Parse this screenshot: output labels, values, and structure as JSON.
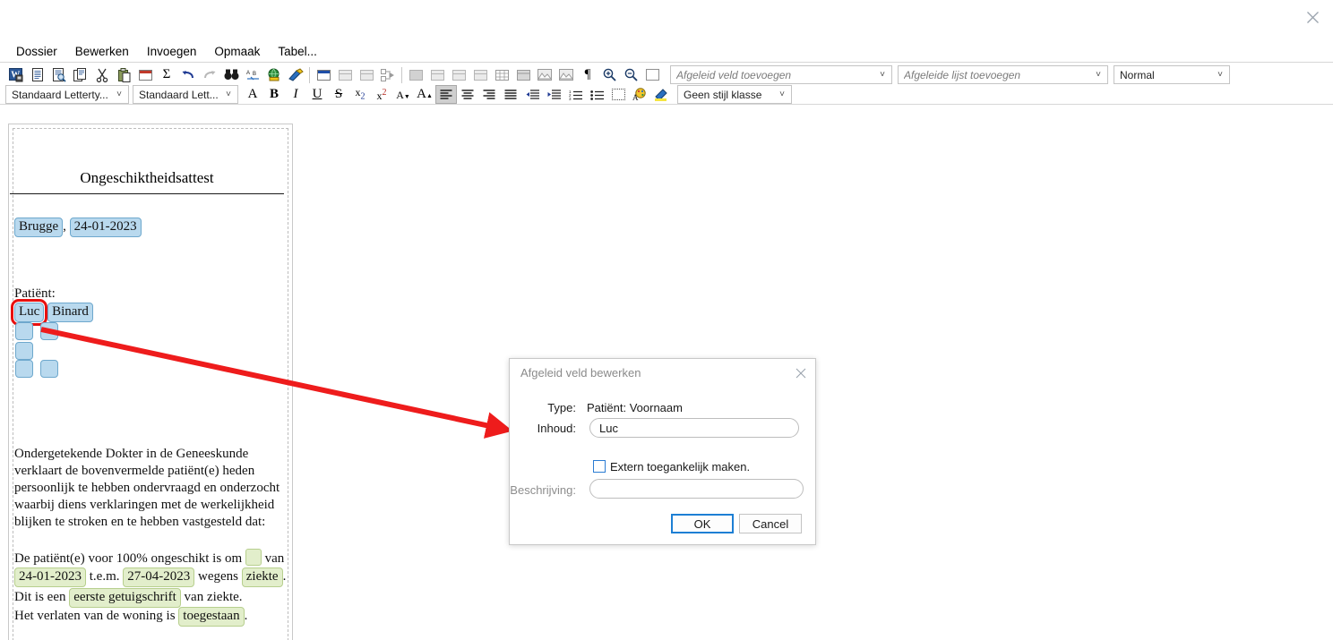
{
  "window": {
    "close_icon": "close-icon"
  },
  "menubar": {
    "items": [
      {
        "label": "Dossier"
      },
      {
        "label": "Bewerken"
      },
      {
        "label": "Invoegen"
      },
      {
        "label": "Opmaak"
      },
      {
        "label": "Tabel..."
      }
    ]
  },
  "toolbar": {
    "row1": [
      {
        "name": "save-document-icon",
        "glyph": "W",
        "kind": "word"
      },
      {
        "name": "new-document-icon",
        "glyph": "☰",
        "kind": "doc"
      },
      {
        "name": "print-preview-icon",
        "glyph": "⌕",
        "kind": "preview"
      },
      {
        "name": "copy-icon",
        "glyph": "⧉",
        "kind": "copy"
      },
      {
        "name": "cut-icon",
        "glyph": "✂",
        "kind": "cut"
      },
      {
        "name": "paste-icon",
        "glyph": "ὌB",
        "kind": "paste"
      },
      {
        "name": "insert-table-icon",
        "glyph": "▦",
        "kind": "grid-red"
      },
      {
        "name": "sum-icon",
        "glyph": "Σ",
        "kind": "text"
      },
      {
        "name": "undo-icon",
        "glyph": "↶",
        "kind": "undo"
      },
      {
        "name": "redo-icon",
        "glyph": "↷",
        "kind": "redo-dim"
      },
      {
        "name": "find-icon",
        "glyph": "இ",
        "kind": "binoculars"
      },
      {
        "name": "spellcheck-icon",
        "glyph": "ABC",
        "kind": "spell"
      },
      {
        "name": "hyperlink-icon",
        "glyph": "ἱ0",
        "kind": "globe"
      },
      {
        "name": "format-painter-icon",
        "glyph": "✎",
        "kind": "brush"
      },
      {
        "name": "table-properties-icon",
        "glyph": "▦",
        "kind": "grid-blue"
      },
      {
        "name": "table-row-icon",
        "glyph": "▦",
        "kind": "grid-gray"
      },
      {
        "name": "table-column-icon",
        "glyph": "▦",
        "kind": "grid-gray"
      },
      {
        "name": "table-split-icon",
        "glyph": "▦",
        "kind": "grid-gray"
      },
      {
        "name": "split-cells-icon",
        "glyph": "⎇",
        "kind": "split"
      },
      {
        "name": "merge-cells-icon",
        "glyph": "▦",
        "kind": "grid-filled"
      },
      {
        "name": "table-cell-a-icon",
        "glyph": "▦",
        "kind": "grid-gray"
      },
      {
        "name": "table-cell-b-icon",
        "glyph": "▦",
        "kind": "grid-gray"
      },
      {
        "name": "table-cell-c-icon",
        "glyph": "▦",
        "kind": "grid-gray"
      },
      {
        "name": "table-cell-d-icon",
        "glyph": "▦",
        "kind": "grid-gray"
      },
      {
        "name": "table-grid-lines-icon",
        "glyph": "▦",
        "kind": "grid-gray"
      },
      {
        "name": "table-shading-icon",
        "glyph": "▦",
        "kind": "grid-gray"
      },
      {
        "name": "insert-image-icon",
        "glyph": "⛰",
        "kind": "image"
      },
      {
        "name": "insert-image-alt-icon",
        "glyph": "⛰",
        "kind": "image"
      },
      {
        "name": "show-formatting-marks-icon",
        "glyph": "¶",
        "kind": "text"
      },
      {
        "name": "zoom-in-icon",
        "glyph": "⊕",
        "kind": "zoomin"
      },
      {
        "name": "zoom-out-icon",
        "glyph": "⊖",
        "kind": "zoomout"
      },
      {
        "name": "page-border-icon",
        "glyph": "□",
        "kind": "square"
      }
    ],
    "row2": [
      {
        "name": "font-color-a-icon",
        "glyph": "A",
        "kind": "serifA"
      },
      {
        "name": "bold-icon",
        "glyph": "B",
        "kind": "bold"
      },
      {
        "name": "italic-icon",
        "glyph": "I",
        "kind": "italic"
      },
      {
        "name": "underline-icon",
        "glyph": "U",
        "kind": "underline"
      },
      {
        "name": "strikethrough-icon",
        "glyph": "S",
        "kind": "strike"
      },
      {
        "name": "subscript-icon",
        "glyph": "x₂",
        "kind": "sub"
      },
      {
        "name": "superscript-icon",
        "glyph": "x²",
        "kind": "sup"
      },
      {
        "name": "decrease-font-size-icon",
        "glyph": "A▾",
        "kind": "fontdown"
      },
      {
        "name": "increase-font-size-icon",
        "glyph": "A▴",
        "kind": "fontup"
      },
      {
        "name": "align-left-icon",
        "glyph": "≡",
        "kind": "align",
        "active": true
      },
      {
        "name": "align-center-icon",
        "glyph": "≡",
        "kind": "align"
      },
      {
        "name": "align-right-icon",
        "glyph": "≡",
        "kind": "align"
      },
      {
        "name": "align-justify-icon",
        "glyph": "≡",
        "kind": "align"
      },
      {
        "name": "decrease-indent-icon",
        "glyph": "⇤",
        "kind": "indent"
      },
      {
        "name": "increase-indent-icon",
        "glyph": "⇥",
        "kind": "indent"
      },
      {
        "name": "numbered-list-icon",
        "glyph": "☰",
        "kind": "numlist"
      },
      {
        "name": "bulleted-list-icon",
        "glyph": "☰",
        "kind": "bullist"
      },
      {
        "name": "borders-icon",
        "glyph": "⬚",
        "kind": "dashbox"
      },
      {
        "name": "font-color-icon",
        "glyph": "◕",
        "kind": "palette"
      },
      {
        "name": "highlight-color-icon",
        "glyph": "✎",
        "kind": "highlighter"
      }
    ],
    "font_family": {
      "value": "Standaard Letterty...",
      "name": "font-family-select"
    },
    "font_style": {
      "value": "Standaard Lett...",
      "name": "font-style-select"
    },
    "derived_field": {
      "placeholder": "Afgeleid veld toevoegen",
      "name": "derived-field-select"
    },
    "derived_list": {
      "placeholder": "Afgeleide lijst toevoegen",
      "name": "derived-list-select"
    },
    "paragraph_style": {
      "value": "Normal",
      "name": "paragraph-style-select"
    },
    "style_class": {
      "value": "Geen stijl klasse",
      "name": "style-class-select"
    }
  },
  "document": {
    "title": "Ongeschiktheidsattest",
    "place_field": "Brugge",
    "comma": ",",
    "date_field": "24-01-2023",
    "patient_label": "Patiënt:",
    "patient_firstname": "Luc",
    "patient_lastname": "Binard",
    "body": {
      "p1_line1": "Ondergetekende Dokter in de Geneeskunde",
      "p1_line2": "verklaart de bovenvermelde patiënt(e) heden",
      "p1_line3": "persoonlijk te hebben ondervraagd en onderzocht",
      "p1_line4": "waarbij diens verklaringen met de werkelijkheid",
      "p1_line5": "blijken te stroken en te hebben vastgesteld dat:",
      "p2_pre": "De patiënt(e) voor 100% ongeschikt is om",
      "p2_post": "van",
      "p2_date_from": "24-01-2023",
      "p2_mid": "t.e.m.",
      "p2_date_to": "27-04-2023",
      "p2_reason_pre": "wegens",
      "p2_reason": "ziekte",
      "p2_period": ".",
      "p3_pre": "Dit is een",
      "p3_field": "eerste getuigschrift",
      "p3_post": "van ziekte.",
      "p4_pre": "Het verlaten van de woning is",
      "p4_field": "toegestaan",
      "p4_post": "."
    }
  },
  "dialog": {
    "title": "Afgeleid veld bewerken",
    "close_icon": "close-icon",
    "type_label": "Type:",
    "type_value": "Patiënt: Voornaam",
    "content_label": "Inhoud:",
    "content_value": "Luc",
    "checkbox_label": "Extern toegankelijk maken.",
    "checkbox_checked": false,
    "description_label": "Beschrijving:",
    "description_value": "",
    "ok_label": "OK",
    "cancel_label": "Cancel"
  },
  "annotation": {
    "arrow_color": "#ee1c1c",
    "selection_color": "#e8100f"
  }
}
